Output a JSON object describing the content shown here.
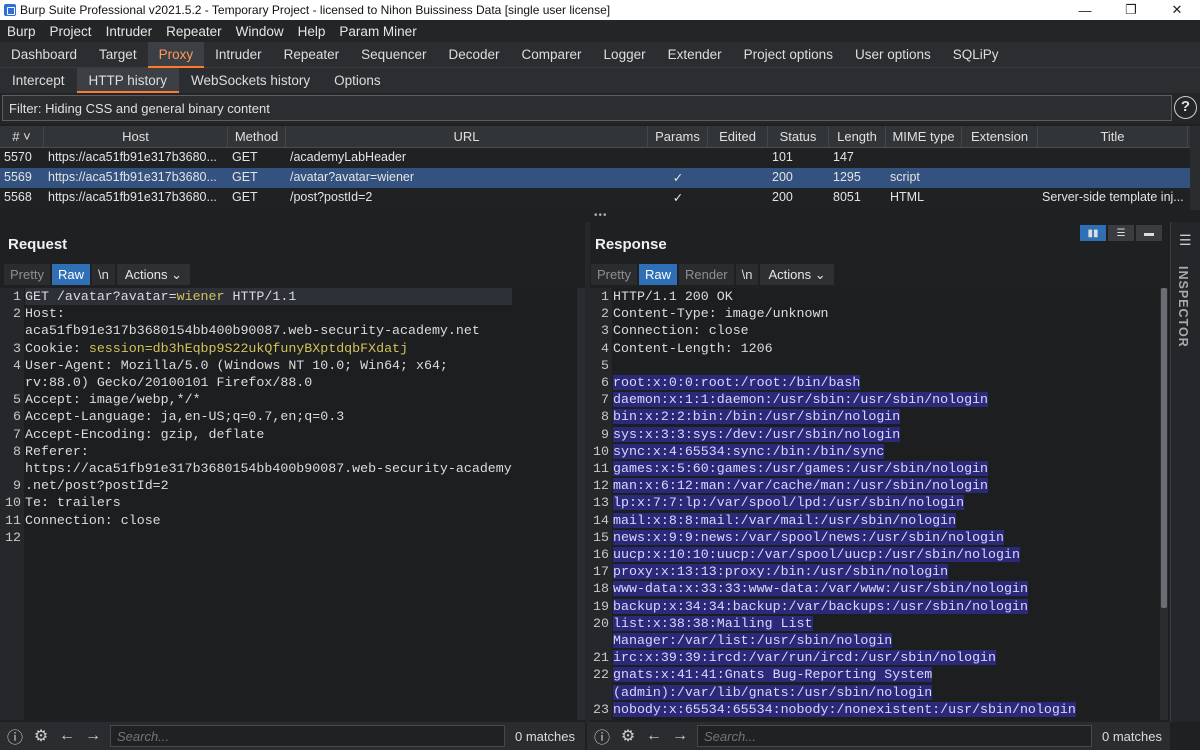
{
  "window": {
    "title": "Burp Suite Professional v2021.5.2 - Temporary Project - licensed to Nihon Buissiness Data [single user license]"
  },
  "menu": [
    "Burp",
    "Project",
    "Intruder",
    "Repeater",
    "Window",
    "Help",
    "Param Miner"
  ],
  "main_tabs": [
    "Dashboard",
    "Target",
    "Proxy",
    "Intruder",
    "Repeater",
    "Sequencer",
    "Decoder",
    "Comparer",
    "Logger",
    "Extender",
    "Project options",
    "User options",
    "SQLiPy"
  ],
  "sub_tabs": [
    "Intercept",
    "HTTP history",
    "WebSockets history",
    "Options"
  ],
  "filter": {
    "text": "Filter: Hiding CSS and general binary content"
  },
  "history": {
    "columns": [
      "# ˅",
      "Host",
      "Method",
      "URL",
      "Params",
      "Edited",
      "Status",
      "Length",
      "MIME type",
      "Extension",
      "Title"
    ],
    "rows": [
      [
        "5570",
        "https://aca51fb91e317b3680...",
        "GET",
        "/academyLabHeader",
        "",
        "",
        "101",
        "147",
        "",
        "",
        ""
      ],
      [
        "5569",
        "https://aca51fb91e317b3680...",
        "GET",
        "/avatar?avatar=wiener",
        "✓",
        "",
        "200",
        "1295",
        "script",
        "",
        ""
      ],
      [
        "5568",
        "https://aca51fb91e317b3680...",
        "GET",
        "/post?postId=2",
        "✓",
        "",
        "200",
        "8051",
        "HTML",
        "",
        "Server-side template inj..."
      ]
    ]
  },
  "request": {
    "title": "Request",
    "tools": [
      "Pretty",
      "Raw",
      "\\n",
      "Actions"
    ],
    "gutter": [
      "1",
      "2",
      "",
      "3",
      "4",
      "",
      "5",
      "6",
      "7",
      "8",
      "",
      "9",
      "10",
      "11",
      "12"
    ],
    "lines": [
      {
        "k": "GET /avatar?avatar=",
        "v": "wiener",
        "r": " HTTP/1.1"
      },
      {
        "k": "Host:",
        "v": "",
        "r": ""
      },
      {
        "k": "aca51fb91e317b3680154bb400b90087.web-security-academy.net",
        "v": "",
        "r": ""
      },
      {
        "k": "Cookie: ",
        "v": "session=db3hEqbp9S22ukQfunyBXptdqbFXdatj",
        "r": ""
      },
      {
        "k": "User-Agent: Mozilla/5.0 (Windows NT 10.0; Win64; x64;",
        "v": "",
        "r": ""
      },
      {
        "k": "rv:88.0) Gecko/20100101 Firefox/88.0",
        "v": "",
        "r": ""
      },
      {
        "k": "Accept: image/webp,*/*",
        "v": "",
        "r": ""
      },
      {
        "k": "Accept-Language: ja,en-US;q=0.7,en;q=0.3",
        "v": "",
        "r": ""
      },
      {
        "k": "Accept-Encoding: gzip, deflate",
        "v": "",
        "r": ""
      },
      {
        "k": "Referer:",
        "v": "",
        "r": ""
      },
      {
        "k": "https://aca51fb91e317b3680154bb400b90087.web-security-academy",
        "v": "",
        "r": ""
      },
      {
        "k": ".net/post?postId=2",
        "v": "",
        "r": ""
      },
      {
        "k": "Te: trailers",
        "v": "",
        "r": ""
      },
      {
        "k": "Connection: close",
        "v": "",
        "r": ""
      },
      {
        "k": "",
        "v": "",
        "r": ""
      },
      {
        "k": "",
        "v": "",
        "r": ""
      }
    ],
    "search_placeholder": "Search...",
    "matches": "0 matches"
  },
  "response": {
    "title": "Response",
    "tools": [
      "Pretty",
      "Raw",
      "Render",
      "\\n",
      "Actions"
    ],
    "gutter": [
      "1",
      "2",
      "3",
      "4",
      "5",
      "6",
      "7",
      "8",
      "9",
      "10",
      "11",
      "12",
      "13",
      "14",
      "15",
      "16",
      "17",
      "18",
      "19",
      "20",
      "",
      "21",
      "22",
      "",
      "23"
    ],
    "header_lines": [
      "HTTP/1.1 200 OK",
      "Content-Type: image/unknown",
      "Connection: close",
      "Content-Length: 1206",
      ""
    ],
    "body_lines": [
      "root:x:0:0:root:/root:/bin/bash",
      "daemon:x:1:1:daemon:/usr/sbin:/usr/sbin/nologin",
      "bin:x:2:2:bin:/bin:/usr/sbin/nologin",
      "sys:x:3:3:sys:/dev:/usr/sbin/nologin",
      "sync:x:4:65534:sync:/bin:/bin/sync",
      "games:x:5:60:games:/usr/games:/usr/sbin/nologin",
      "man:x:6:12:man:/var/cache/man:/usr/sbin/nologin",
      "lp:x:7:7:lp:/var/spool/lpd:/usr/sbin/nologin",
      "mail:x:8:8:mail:/var/mail:/usr/sbin/nologin",
      "news:x:9:9:news:/var/spool/news:/usr/sbin/nologin",
      "uucp:x:10:10:uucp:/var/spool/uucp:/usr/sbin/nologin",
      "proxy:x:13:13:proxy:/bin:/usr/sbin/nologin",
      "www-data:x:33:33:www-data:/var/www:/usr/sbin/nologin",
      "backup:x:34:34:backup:/var/backups:/usr/sbin/nologin",
      "list:x:38:38:Mailing List",
      "Manager:/var/list:/usr/sbin/nologin",
      "irc:x:39:39:ircd:/var/run/ircd:/usr/sbin/nologin",
      "gnats:x:41:41:Gnats Bug-Reporting System",
      "(admin):/var/lib/gnats:/usr/sbin/nologin",
      "nobody:x:65534:65534:nobody:/nonexistent:/usr/sbin/nologin"
    ],
    "search_placeholder": "Search...",
    "matches": "0 matches"
  },
  "inspector": {
    "label": "INSPECTOR"
  },
  "colors": {
    "accent": "#ff7a2f",
    "selection": "#34527f",
    "highlight": "#2c2a78"
  }
}
